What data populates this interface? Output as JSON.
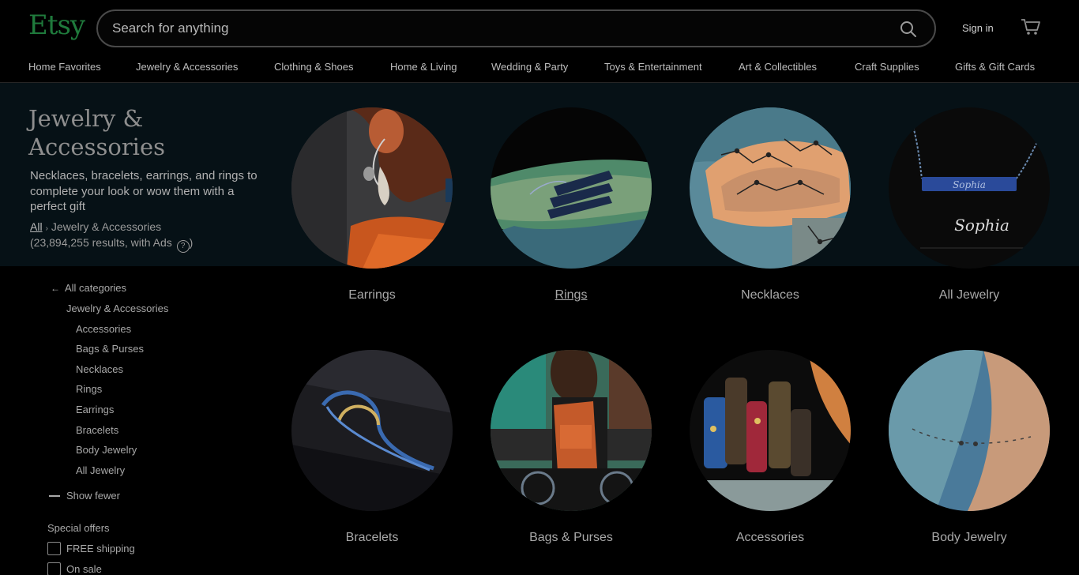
{
  "header": {
    "logo": "Etsy",
    "search_placeholder": "Search for anything",
    "sign_in": "Sign in"
  },
  "nav": [
    "Home Favorites",
    "Jewelry & Accessories",
    "Clothing & Shoes",
    "Home & Living",
    "Wedding & Party",
    "Toys & Entertainment",
    "Art & Collectibles",
    "Craft Supplies",
    "Gifts & Gift Cards"
  ],
  "hero": {
    "title": "Jewelry & Accessories",
    "description": "Necklaces, bracelets, earrings, and rings to complete your look or wow them with a perfect gift",
    "breadcrumb_all": "All",
    "breadcrumb_current": "Jewelry & Accessories",
    "results": "(23,894,255 results, with Ads",
    "results_help": "?",
    "results_close": ")"
  },
  "categories": [
    "Earrings",
    "Rings",
    "Necklaces",
    "All Jewelry",
    "Bracelets",
    "Bags & Purses",
    "Accessories",
    "Body Jewelry"
  ],
  "sidebar": {
    "all_categories": "All categories",
    "parent": "Jewelry & Accessories",
    "items": [
      "Accessories",
      "Bags & Purses",
      "Necklaces",
      "Rings",
      "Earrings",
      "Bracelets",
      "Body Jewelry",
      "All Jewelry"
    ],
    "show_fewer": "Show fewer",
    "special_offers": "Special offers",
    "free_shipping": "FREE shipping",
    "on_sale": "On sale"
  },
  "colors": {
    "logo": "#1f7a3c",
    "hero_bg": "#061116"
  }
}
